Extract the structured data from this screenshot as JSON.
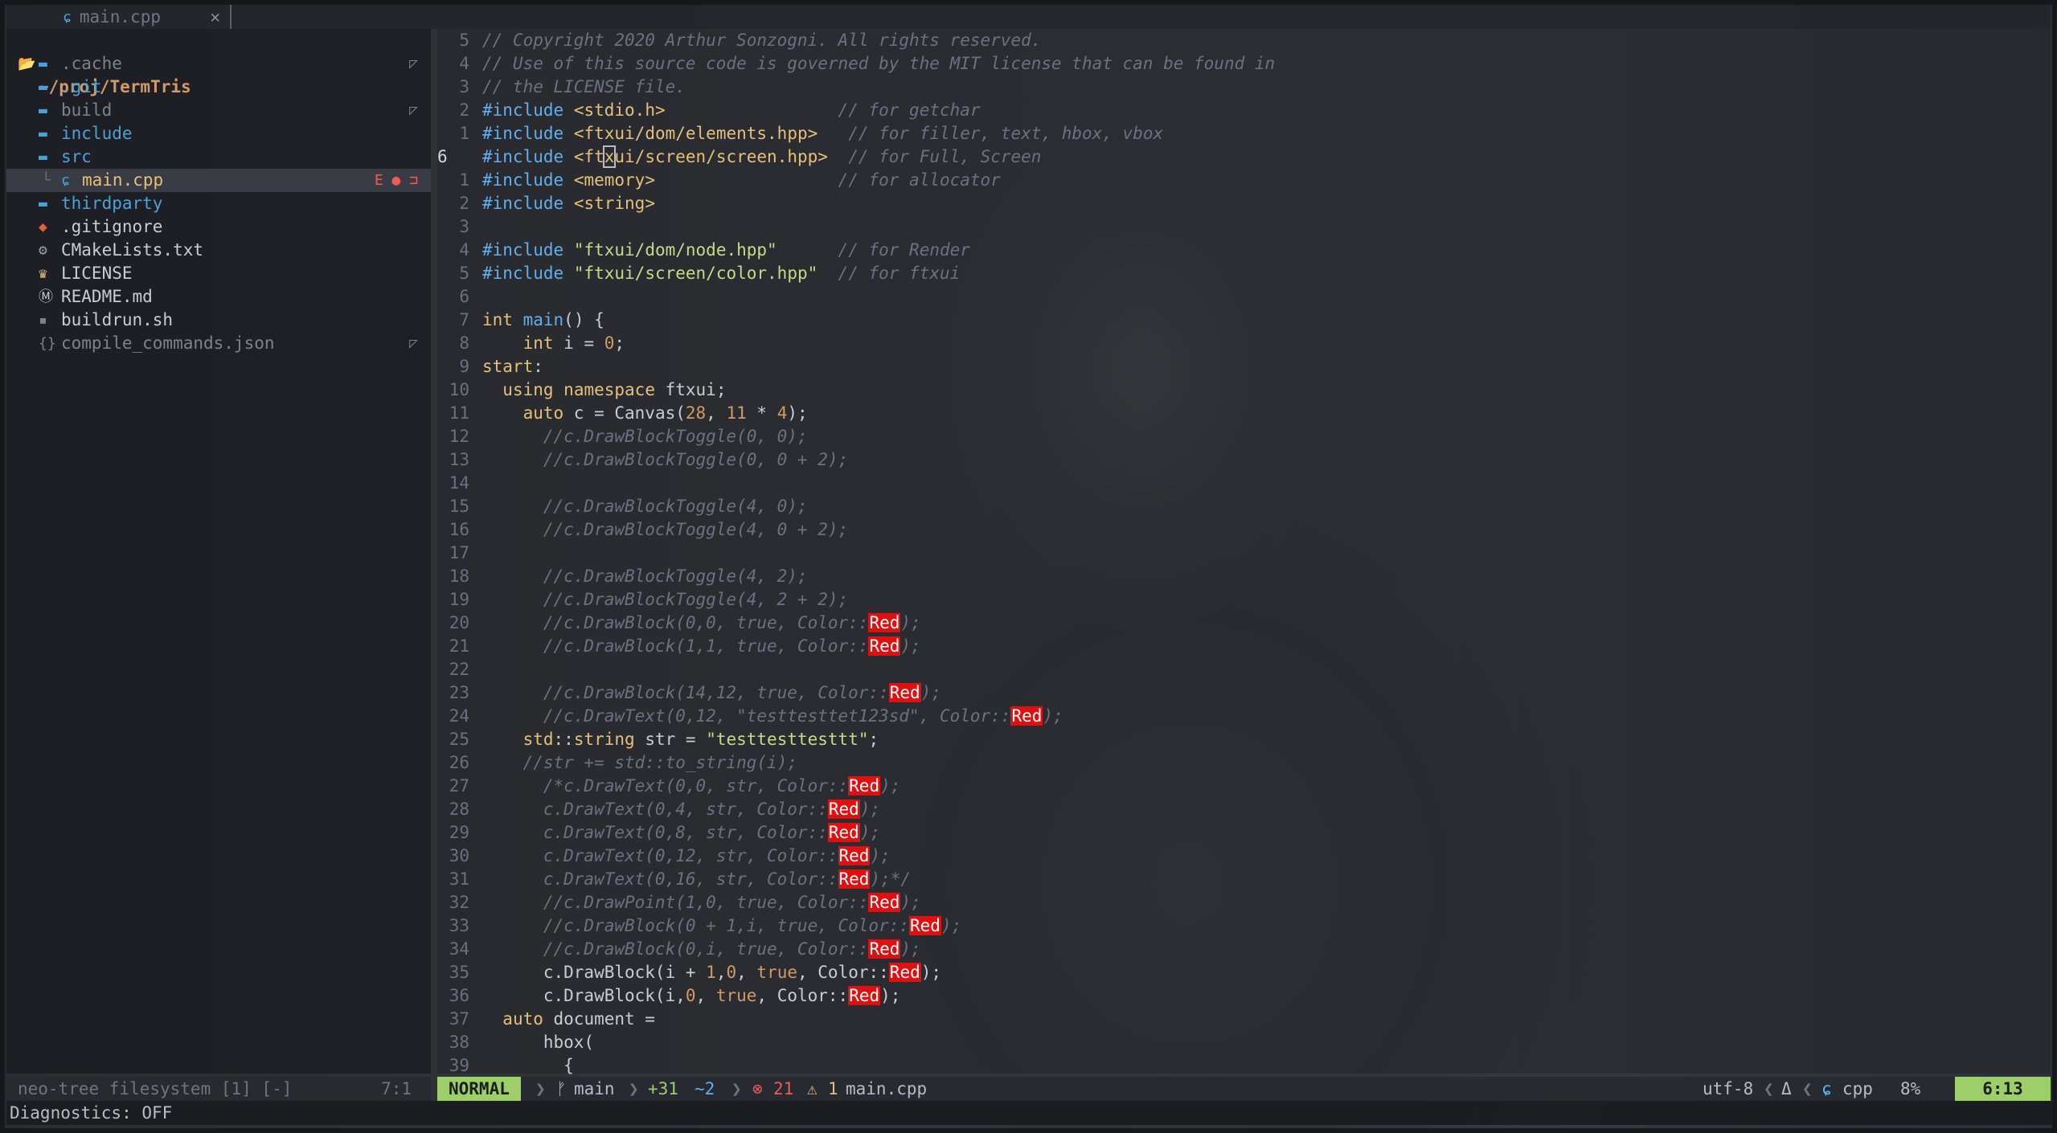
{
  "tab": {
    "label": "main.cpp",
    "close": "✕"
  },
  "sidebar": {
    "root": "~/proj/TermTris",
    "items": [
      {
        "name": ".cache",
        "kind": "folder",
        "dim": true,
        "flag": "◸"
      },
      {
        "name": ".git",
        "kind": "folder",
        "dim": false,
        "flag": ""
      },
      {
        "name": "build",
        "kind": "folder",
        "dim": true,
        "flag": "◸"
      },
      {
        "name": "include",
        "kind": "folder",
        "dim": false,
        "flag": ""
      },
      {
        "name": "src",
        "kind": "folder-open",
        "dim": false,
        "flag": ""
      },
      {
        "name": "main.cpp",
        "kind": "cpp",
        "dim": false,
        "flag": "E ● ⊐",
        "selected": true
      },
      {
        "name": "thirdparty",
        "kind": "folder",
        "dim": false,
        "flag": ""
      },
      {
        "name": ".gitignore",
        "kind": "git",
        "dim": false,
        "flag": ""
      },
      {
        "name": "CMakeLists.txt",
        "kind": "gear",
        "dim": false,
        "flag": ""
      },
      {
        "name": "LICENSE",
        "kind": "license",
        "dim": false,
        "flag": ""
      },
      {
        "name": "README.md",
        "kind": "md",
        "dim": false,
        "flag": ""
      },
      {
        "name": "buildrun.sh",
        "kind": "sh",
        "dim": false,
        "flag": ""
      },
      {
        "name": "compile_commands.json",
        "kind": "json",
        "dim": true,
        "flag": "◸"
      }
    ]
  },
  "editor": {
    "lines": [
      {
        "n": "5",
        "t": [
          [
            "cm",
            "// Copyright 2020 Arthur Sonzogni. All rights reserved."
          ]
        ]
      },
      {
        "n": "4",
        "t": [
          [
            "cm",
            "// Use of this source code is governed by the MIT license that can be found in"
          ]
        ]
      },
      {
        "n": "3",
        "t": [
          [
            "cm",
            "// the LICENSE file."
          ]
        ]
      },
      {
        "n": "2",
        "t": [
          [
            "inc",
            "#include"
          ],
          [
            "id",
            " "
          ],
          [
            "str",
            "<stdio.h>"
          ],
          [
            "id",
            "                 "
          ],
          [
            "cm",
            "// for getchar"
          ]
        ]
      },
      {
        "n": "1",
        "t": [
          [
            "inc",
            "#include"
          ],
          [
            "id",
            " "
          ],
          [
            "str",
            "<ftxui/dom/elements.hpp>"
          ],
          [
            "id",
            "   "
          ],
          [
            "cm",
            "// for filler, text, hbox, vbox"
          ]
        ]
      },
      {
        "n": "6",
        "cur": true,
        "t": [
          [
            "inc",
            "#include"
          ],
          [
            "id",
            " "
          ],
          [
            "str",
            "<ft"
          ],
          [
            "cur",
            "x"
          ],
          [
            "str",
            "ui/screen/screen.hpp>"
          ],
          [
            "id",
            "  "
          ],
          [
            "cm",
            "// for Full, Screen"
          ]
        ]
      },
      {
        "n": "1",
        "t": [
          [
            "inc",
            "#include"
          ],
          [
            "id",
            " "
          ],
          [
            "str",
            "<memory>"
          ],
          [
            "id",
            "                  "
          ],
          [
            "cm",
            "// for allocator"
          ]
        ]
      },
      {
        "n": "2",
        "t": [
          [
            "inc",
            "#include"
          ],
          [
            "id",
            " "
          ],
          [
            "str",
            "<string>"
          ]
        ]
      },
      {
        "n": "3",
        "t": []
      },
      {
        "n": "4",
        "t": [
          [
            "inc",
            "#include"
          ],
          [
            "id",
            " "
          ],
          [
            "strg",
            "\"ftxui/dom/node.hpp\""
          ],
          [
            "id",
            "      "
          ],
          [
            "cm",
            "// for Render"
          ]
        ]
      },
      {
        "n": "5",
        "t": [
          [
            "inc",
            "#include"
          ],
          [
            "id",
            " "
          ],
          [
            "strg",
            "\"ftxui/screen/color.hpp\""
          ],
          [
            "id",
            "  "
          ],
          [
            "cm",
            "// for ftxui"
          ]
        ]
      },
      {
        "n": "6",
        "t": []
      },
      {
        "n": "7",
        "t": [
          [
            "typ",
            "int"
          ],
          [
            "id",
            " "
          ],
          [
            "fn",
            "main"
          ],
          [
            "id",
            "() {"
          ]
        ]
      },
      {
        "n": "8",
        "t": [
          [
            "id",
            "    "
          ],
          [
            "typ",
            "int"
          ],
          [
            "id",
            " i = "
          ],
          [
            "num",
            "0"
          ],
          [
            "id",
            ";"
          ]
        ]
      },
      {
        "n": "9",
        "t": [
          [
            "lbl",
            "start"
          ],
          [
            "id",
            ":"
          ]
        ]
      },
      {
        "n": "10",
        "t": [
          [
            "id",
            "  "
          ],
          [
            "typ",
            "using"
          ],
          [
            "id",
            " "
          ],
          [
            "typ",
            "namespace"
          ],
          [
            "id",
            " ftxui;"
          ]
        ]
      },
      {
        "n": "11",
        "t": [
          [
            "id",
            "    "
          ],
          [
            "typ",
            "auto"
          ],
          [
            "id",
            " c = Canvas("
          ],
          [
            "num",
            "28"
          ],
          [
            "id",
            ", "
          ],
          [
            "num",
            "11"
          ],
          [
            "id",
            " * "
          ],
          [
            "num",
            "4"
          ],
          [
            "id",
            ");"
          ]
        ]
      },
      {
        "n": "12",
        "t": [
          [
            "cm",
            "      //c.DrawBlockToggle(0, 0);"
          ]
        ]
      },
      {
        "n": "13",
        "t": [
          [
            "cm",
            "      //c.DrawBlockToggle(0, 0 + 2);"
          ]
        ]
      },
      {
        "n": "14",
        "t": []
      },
      {
        "n": "15",
        "t": [
          [
            "cm",
            "      //c.DrawBlockToggle(4, 0);"
          ]
        ]
      },
      {
        "n": "16",
        "t": [
          [
            "cm",
            "      //c.DrawBlockToggle(4, 0 + 2);"
          ]
        ]
      },
      {
        "n": "17",
        "t": []
      },
      {
        "n": "18",
        "t": [
          [
            "cm",
            "      //c.DrawBlockToggle(4, 2);"
          ]
        ]
      },
      {
        "n": "19",
        "t": [
          [
            "cm",
            "      //c.DrawBlockToggle(4, 2 + 2);"
          ]
        ]
      },
      {
        "n": "20",
        "t": [
          [
            "cm",
            "      //c.DrawBlock(0,0, true, Color::"
          ],
          [
            "red",
            "Red"
          ],
          [
            "cm",
            ");"
          ]
        ]
      },
      {
        "n": "21",
        "t": [
          [
            "cm",
            "      //c.DrawBlock(1,1, true, Color::"
          ],
          [
            "red",
            "Red"
          ],
          [
            "cm",
            ");"
          ]
        ]
      },
      {
        "n": "22",
        "t": []
      },
      {
        "n": "23",
        "t": [
          [
            "cm",
            "      //c.DrawBlock(14,12, true, Color::"
          ],
          [
            "red",
            "Red"
          ],
          [
            "cm",
            ");"
          ]
        ]
      },
      {
        "n": "24",
        "t": [
          [
            "cm",
            "      //c.DrawText(0,12, \"testtesttet123sd\", Color::"
          ],
          [
            "red",
            "Red"
          ],
          [
            "cm",
            ");"
          ]
        ]
      },
      {
        "n": "25",
        "t": [
          [
            "id",
            "    "
          ],
          [
            "typ",
            "std"
          ],
          [
            "id",
            "::"
          ],
          [
            "typ",
            "string"
          ],
          [
            "id",
            " str = "
          ],
          [
            "strg",
            "\"testtesttesttt\""
          ],
          [
            "id",
            ";"
          ]
        ]
      },
      {
        "n": "26",
        "t": [
          [
            "cm",
            "    //str += std::to_string(i);"
          ]
        ]
      },
      {
        "n": "27",
        "t": [
          [
            "cm",
            "      /*c.DrawText(0,0, str, Color::"
          ],
          [
            "red",
            "Red"
          ],
          [
            "cm",
            ");"
          ]
        ]
      },
      {
        "n": "28",
        "t": [
          [
            "cm",
            "      c.DrawText(0,4, str, Color::"
          ],
          [
            "red",
            "Red"
          ],
          [
            "cm",
            ");"
          ]
        ]
      },
      {
        "n": "29",
        "t": [
          [
            "cm",
            "      c.DrawText(0,8, str, Color::"
          ],
          [
            "red",
            "Red"
          ],
          [
            "cm",
            ");"
          ]
        ]
      },
      {
        "n": "30",
        "t": [
          [
            "cm",
            "      c.DrawText(0,12, str, Color::"
          ],
          [
            "red",
            "Red"
          ],
          [
            "cm",
            ");"
          ]
        ]
      },
      {
        "n": "31",
        "t": [
          [
            "cm",
            "      c.DrawText(0,16, str, Color::"
          ],
          [
            "red",
            "Red"
          ],
          [
            "cm",
            ");*/"
          ]
        ]
      },
      {
        "n": "32",
        "t": [
          [
            "cm",
            "      //c.DrawPoint(1,0, true, Color::"
          ],
          [
            "red",
            "Red"
          ],
          [
            "cm",
            ");"
          ]
        ]
      },
      {
        "n": "33",
        "t": [
          [
            "cm",
            "      //c.DrawBlock(0 + 1,i, true, Color::"
          ],
          [
            "red",
            "Red"
          ],
          [
            "cm",
            ");"
          ]
        ]
      },
      {
        "n": "34",
        "t": [
          [
            "cm",
            "      //c.DrawBlock(0,i, true, Color::"
          ],
          [
            "red",
            "Red"
          ],
          [
            "cm",
            ");"
          ]
        ]
      },
      {
        "n": "35",
        "t": [
          [
            "id",
            "      c.DrawBlock(i + "
          ],
          [
            "num",
            "1"
          ],
          [
            "id",
            ","
          ],
          [
            "num",
            "0"
          ],
          [
            "id",
            ", "
          ],
          [
            "num",
            "true"
          ],
          [
            "id",
            ", Color::"
          ],
          [
            "red",
            "Red"
          ],
          [
            "id",
            ");"
          ]
        ]
      },
      {
        "n": "36",
        "t": [
          [
            "id",
            "      c.DrawBlock(i,"
          ],
          [
            "num",
            "0"
          ],
          [
            "id",
            ", "
          ],
          [
            "num",
            "true"
          ],
          [
            "id",
            ", Color::"
          ],
          [
            "red",
            "Red"
          ],
          [
            "id",
            ");"
          ]
        ]
      },
      {
        "n": "37",
        "t": [
          [
            "id",
            "  "
          ],
          [
            "typ",
            "auto"
          ],
          [
            "id",
            " document ="
          ]
        ]
      },
      {
        "n": "38",
        "t": [
          [
            "id",
            "      hbox("
          ]
        ]
      },
      {
        "n": "39",
        "t": [
          [
            "id",
            "        {"
          ]
        ]
      }
    ]
  },
  "status_left": {
    "text": "neo-tree filesystem [1] [-]",
    "pos": "7:1"
  },
  "status": {
    "mode": "NORMAL",
    "branch": "main",
    "added": "+31",
    "changed": "~2",
    "errors": "21",
    "warnings": "1",
    "file": "main.cpp",
    "encoding": "utf-8",
    "filetype": "cpp",
    "percent": "8%",
    "position": "6:13"
  },
  "cmdline": "Diagnostics: OFF",
  "colors": {
    "accent": "#9ece6a",
    "error": "#e01010",
    "folder": "#4aa3d8"
  }
}
